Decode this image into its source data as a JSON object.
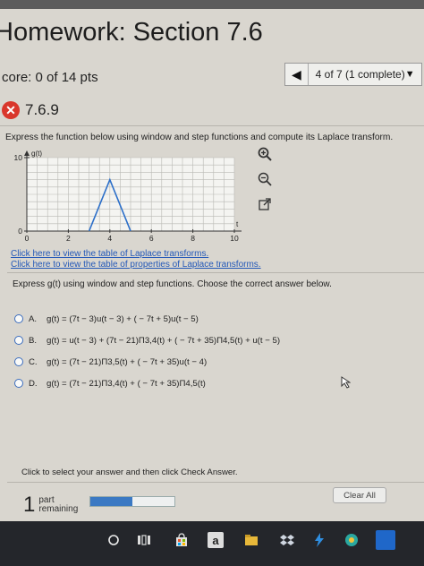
{
  "header": {
    "title": "Homework: Section 7.6",
    "score": "core: 0 of 14 pts",
    "nav_label": "4 of 7 (1 complete)"
  },
  "problem": {
    "number": "7.6.9",
    "status": "incorrect",
    "instruction": "Express the function below using window and step functions and compute its Laplace transform."
  },
  "chart_data": {
    "type": "line",
    "ylabel": "g(t)",
    "xlabel": "t",
    "x_ticks": [
      "0",
      "2",
      "4",
      "6",
      "8",
      "10"
    ],
    "y_ticks": [
      "0",
      "10"
    ],
    "xlim": [
      0,
      10
    ],
    "ylim": [
      0,
      10
    ],
    "grid": true,
    "series": [
      {
        "x": [
          3,
          4,
          5
        ],
        "y": [
          0,
          7,
          0
        ]
      }
    ]
  },
  "links": {
    "laplace_table": "Click here to view the table of Laplace transforms.",
    "properties_table": "Click here to view the table of properties of Laplace transforms."
  },
  "question": {
    "prompt": "Express g(t) using window and step functions. Choose the correct answer below.",
    "options": [
      {
        "letter": "A.",
        "text": "g(t) = (7t − 3)u(t − 3) + ( − 7t + 5)u(t − 5)"
      },
      {
        "letter": "B.",
        "text": "g(t) = u(t − 3) + (7t − 21)Π3,4(t) + ( − 7t + 35)Π4,5(t) + u(t − 5)"
      },
      {
        "letter": "C.",
        "text": "g(t) = (7t − 21)Π3,5(t) + ( − 7t + 35)u(t − 4)"
      },
      {
        "letter": "D.",
        "text": "g(t) = (7t − 21)Π3,4(t) + ( − 7t + 35)Π4,5(t)"
      }
    ]
  },
  "footer": {
    "note": "Click to select your answer and then click Check Answer.",
    "remaining_count": "1",
    "remaining_label_1": "part",
    "remaining_label_2": "remaining",
    "progress": 0.5,
    "clear_label": "Clear All"
  },
  "colors": {
    "accent": "#3b79c3",
    "error": "#d9362b",
    "link": "#2358b8"
  }
}
